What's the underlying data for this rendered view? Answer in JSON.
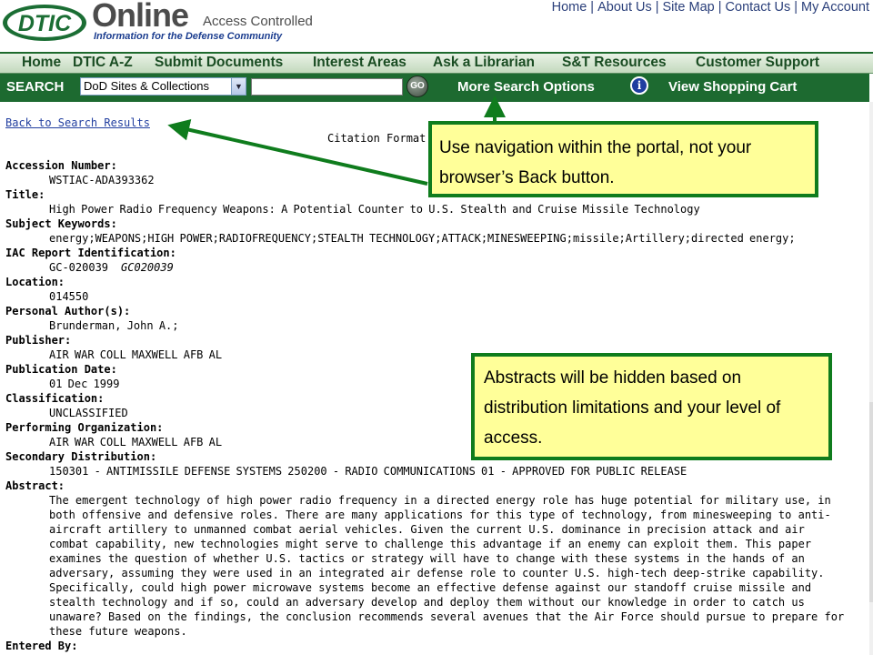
{
  "header": {
    "logo_text": "DTIC",
    "brand": "Online",
    "brand_suffix": "Access Controlled",
    "tagline": "Information for the Defense Community",
    "util_nav": [
      "Home",
      "About Us",
      "Site Map",
      "Contact Us",
      "My Account"
    ]
  },
  "main_nav": [
    "Home",
    "DTIC A-Z",
    "Submit Documents",
    "Interest Areas",
    "Ask a Librarian",
    "S&T Resources",
    "Customer Support"
  ],
  "search": {
    "label": "SEARCH",
    "scope_selected": "DoD Sites & Collections",
    "query_value": "",
    "go_label": "GO",
    "more_options": "More Search Options",
    "info_glyph": "i",
    "view_cart": "View Shopping Cart"
  },
  "citation": {
    "back_link": "Back to Search Results",
    "format_label": "Citation Format:",
    "fields": [
      {
        "label": "Accession Number:",
        "value": "WSTIAC-ADA393362"
      },
      {
        "label": "Title:",
        "value": "High Power Radio Frequency Weapons: A Potential Counter to U.S. Stealth and Cruise Missile Technology"
      },
      {
        "label": "Subject Keywords:",
        "value": "energy;WEAPONS;HIGH POWER;RADIOFREQUENCY;STEALTH TECHNOLOGY;ATTACK;MINESWEEPING;missile;Artillery;directed energy;"
      },
      {
        "label": "IAC Report Identification:",
        "value": "GC-020039",
        "value_italic": "GC020039"
      },
      {
        "label": "Location:",
        "value": "014550"
      },
      {
        "label": "Personal Author(s):",
        "value": "Brunderman, John A.;"
      },
      {
        "label": "Publisher:",
        "value": "AIR WAR COLL MAXWELL AFB AL"
      },
      {
        "label": "Publication Date:",
        "value": "01 Dec 1999"
      },
      {
        "label": "Classification:",
        "value": "UNCLASSIFIED"
      },
      {
        "label": "Performing Organization:",
        "value": "AIR WAR COLL MAXWELL AFB AL"
      },
      {
        "label": "Secondary Distribution:",
        "value": "150301 - ANTIMISSILE DEFENSE SYSTEMS 250200 - RADIO COMMUNICATIONS 01 - APPROVED FOR PUBLIC RELEASE"
      }
    ],
    "abstract_label": "Abstract:",
    "abstract": "The emergent technology of high power radio frequency in a directed energy role has huge potential for military use, in both offensive and defensive roles. There are many applications for this type of technology, from minesweeping to anti-aircraft artillery to unmanned combat aerial vehicles. Given the current U.S. dominance in precision attack and air combat capability, new technologies might serve to challenge this advantage if an enemy can exploit them. This paper examines the question of whether U.S. tactics or strategy will have to change with these systems in the hands of an adversary, assuming they were used in an integrated air defense role to counter U.S. high-tech deep-strike capability. Specifically, could high power microwave systems become an effective defense against our standoff cruise missile and stealth technology and if so, could an adversary develop and deploy them without our knowledge in order to catch us unaware? Based on the findings, the conclusion recommends several avenues that the Air Force should pursue to prepare for these future weapons.",
    "entered_by_label": "Entered By:"
  },
  "callouts": {
    "navigation": "Use navigation within the portal, not your browser’s Back button.",
    "abstracts": "Abstracts will be hidden based on distribution limitations and your level of access."
  },
  "colors": {
    "nav_green": "#1d6a30",
    "callout_fill": "#ffff99",
    "callout_border": "#0f7c1d",
    "link_blue": "#223fa0"
  }
}
